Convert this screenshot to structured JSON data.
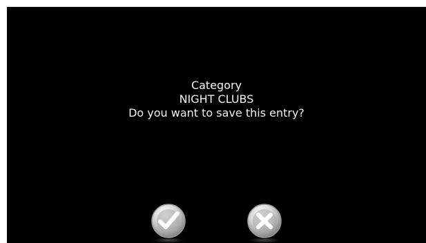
{
  "dialog": {
    "label": "Category",
    "value": "NIGHT CLUBS",
    "question": "Do you want to save this entry?"
  },
  "buttons": {
    "confirm_icon": "checkmark-icon",
    "cancel_icon": "close-icon"
  },
  "colors": {
    "background": "#000000",
    "text": "#f2f2f2",
    "button_face": "#d9d9d9",
    "button_mark": "#ffffff"
  }
}
